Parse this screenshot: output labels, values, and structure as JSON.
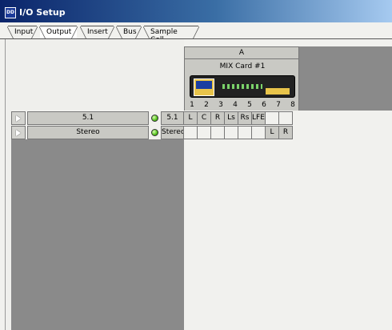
{
  "window": {
    "title": "I/O Setup",
    "icon": "app-logo-icon"
  },
  "tabs": [
    {
      "label": "Input",
      "active": false
    },
    {
      "label": "Output",
      "active": true
    },
    {
      "label": "Insert",
      "active": false
    },
    {
      "label": "Bus",
      "active": false
    },
    {
      "label": "Sample Cell",
      "active": false
    }
  ],
  "card": {
    "column_label": "A",
    "name": "MIX Card #1",
    "device_image": "adat-bridge-device",
    "channels": [
      "1",
      "2",
      "3",
      "4",
      "5",
      "6",
      "7",
      "8"
    ]
  },
  "paths": [
    {
      "name": "5.1",
      "format": "5.1",
      "assignments": [
        "L",
        "C",
        "R",
        "Ls",
        "Rs",
        "LFE",
        "",
        ""
      ]
    },
    {
      "name": "Stereo",
      "format": "Stereo",
      "assignments": [
        "",
        "",
        "",
        "",
        "",
        "",
        "L",
        "R"
      ]
    }
  ],
  "colors": {
    "active_led": "#52c21a",
    "panel_gray": "#8a8a8a",
    "cell_bg": "#c9c9c4"
  }
}
